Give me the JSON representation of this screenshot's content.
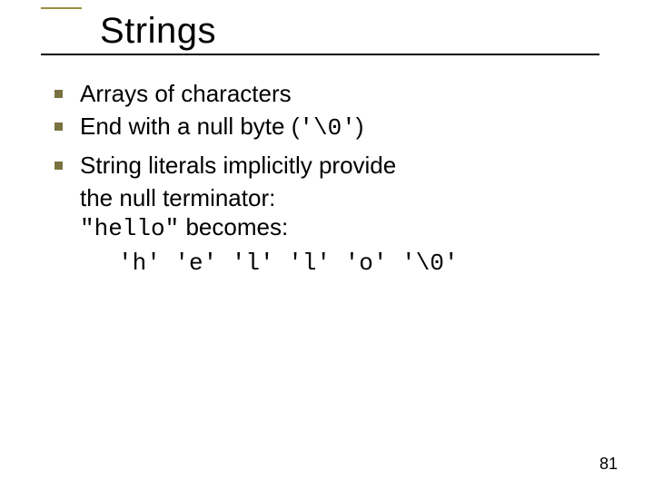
{
  "title": "Strings",
  "bullets": {
    "b1": "Arrays of characters",
    "b2_pre": "End with a null byte (",
    "b2_code": "'\\0'",
    "b2_post": ")",
    "b3_l1": "String literals implicitly provide",
    "b3_l2": "the null terminator:",
    "b3_code": "\"hello\"",
    "b3_after": " becomes:",
    "b3_chars": "'h' 'e' 'l' 'l' 'o' '\\0'"
  },
  "page_number": "81"
}
